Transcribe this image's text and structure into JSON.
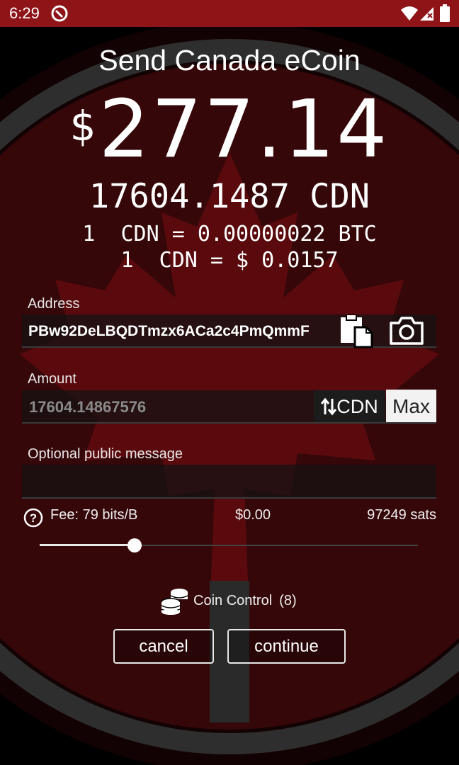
{
  "status_bar": {
    "time": "6:29",
    "background": "#8e1418"
  },
  "header": {
    "title": "Send Canada eCoin"
  },
  "balance": {
    "fiat_symbol": "$",
    "fiat_value": "277.14",
    "crypto_line": "17604.1487 CDN",
    "rate_btc": "1  CDN = 0.00000022 BTC",
    "rate_fiat": "1  CDN = $ 0.0157"
  },
  "address": {
    "label": "Address",
    "value": "PBw92DeLBQDTmzx6ACa2c4PmQmmF"
  },
  "amount": {
    "label": "Amount",
    "value": "17604.14867576",
    "unit_label": "CDN",
    "max_label": "Max"
  },
  "message": {
    "label": "Optional public message",
    "value": ""
  },
  "fee": {
    "label": "Fee: 79 bits/B",
    "fiat": "$0.00",
    "sats": "97249 sats",
    "slider_fraction": 0.25
  },
  "coin_control": {
    "label": "Coin Control",
    "count": "(8)"
  },
  "actions": {
    "cancel_label": "cancel",
    "continue_label": "continue"
  },
  "icons": [
    "no-disturb-icon",
    "wifi-icon",
    "signal-icon",
    "battery-icon",
    "paste-icon",
    "camera-icon",
    "swap-icon",
    "help-icon",
    "coins-icon"
  ],
  "colors": {
    "accent_red": "#8e1418",
    "background": "#000000"
  }
}
